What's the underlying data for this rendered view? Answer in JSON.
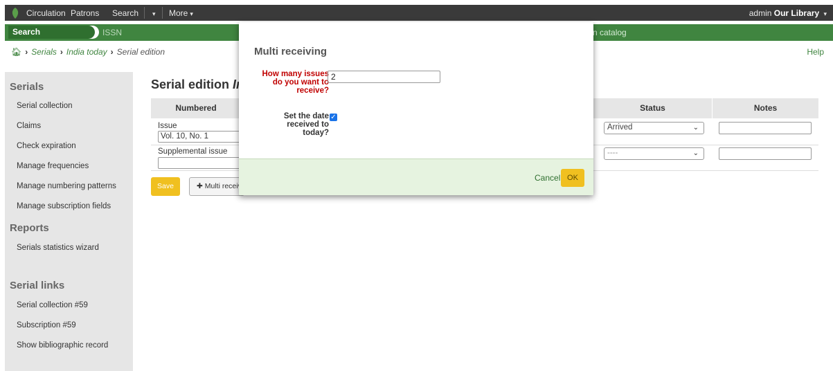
{
  "topbar": {
    "nav": [
      "Circulation",
      "Patrons",
      "Search",
      "More"
    ],
    "user": "admin",
    "library": "Our Library"
  },
  "greenbar": {
    "search_tab": "Search subscriptions",
    "issn": "ISSN",
    "catalog": "n catalog"
  },
  "breadcrumb": {
    "items": [
      "Serials",
      "India today",
      "Serial edition"
    ],
    "help": "Help"
  },
  "sidebar": {
    "serials_heading": "Serials",
    "serials_items": [
      "Serial collection",
      "Claims",
      "Check expiration",
      "Manage frequencies",
      "Manage numbering patterns",
      "Manage subscription fields"
    ],
    "reports_heading": "Reports",
    "reports_items": [
      "Serials statistics wizard"
    ],
    "links_heading": "Serial links",
    "links_items": [
      "Serial collection #59",
      "Subscription #59",
      "Show bibliographic record"
    ]
  },
  "main": {
    "title_prefix": "Serial edition",
    "title_italic": "In",
    "columns": {
      "numbered": "Numbered",
      "status": "Status",
      "notes": "Notes"
    },
    "rows": [
      {
        "label": "Issue",
        "value": "Vol. 10, No. 1",
        "status": "Arrived"
      },
      {
        "label": "Supplemental issue",
        "value": "",
        "status": "----"
      }
    ],
    "save": "Save",
    "multi": "Multi receiving"
  },
  "modal": {
    "title": "Multi receiving",
    "q1": "How many issues do you want to receive?",
    "q1_value": "2",
    "q2": "Set the date received to today?",
    "q2_checked": true,
    "cancel": "Cancel",
    "ok": "OK"
  },
  "colors": {
    "green": "#408540",
    "yellow": "#f0c020",
    "required": "#c00000"
  }
}
